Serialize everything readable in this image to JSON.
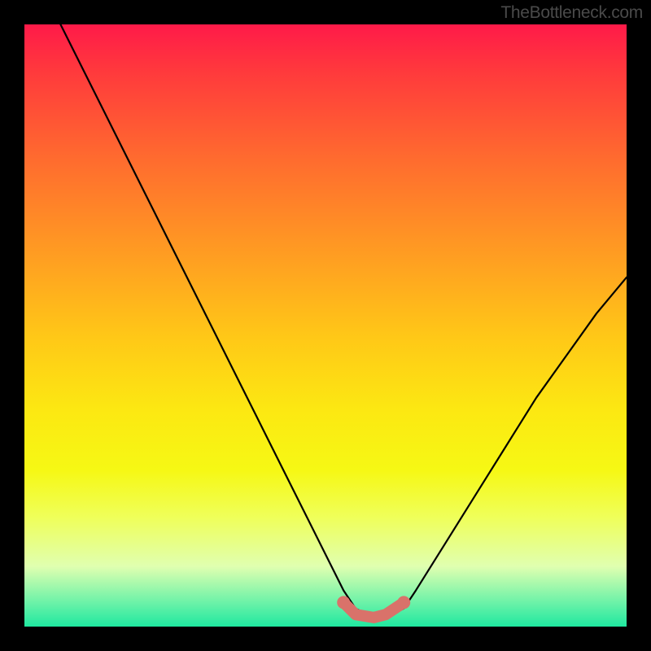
{
  "watermark": "TheBottleneck.com",
  "chart_data": {
    "type": "line",
    "title": "",
    "xlabel": "",
    "ylabel": "",
    "xlim": [
      0,
      100
    ],
    "ylim": [
      0,
      100
    ],
    "grid": false,
    "series": [
      {
        "name": "bottleneck-curve",
        "x": [
          6,
          10,
          15,
          20,
          25,
          30,
          35,
          40,
          45,
          50,
          53,
          55,
          58,
          60,
          63,
          65,
          70,
          75,
          80,
          85,
          90,
          95,
          100
        ],
        "y": [
          100,
          92,
          82,
          72,
          62,
          52,
          42,
          32,
          22,
          12,
          6,
          3,
          1.5,
          1.5,
          3,
          6,
          14,
          22,
          30,
          38,
          45,
          52,
          58
        ]
      },
      {
        "name": "minimum-band",
        "x": [
          53,
          55,
          58,
          60,
          63
        ],
        "y": [
          4,
          2,
          1.5,
          2,
          4
        ]
      }
    ],
    "colors": {
      "curve": "#000000",
      "band": "#d9726a",
      "gradient_top": "#ff1a49",
      "gradient_bottom": "#1fe8a0"
    }
  }
}
